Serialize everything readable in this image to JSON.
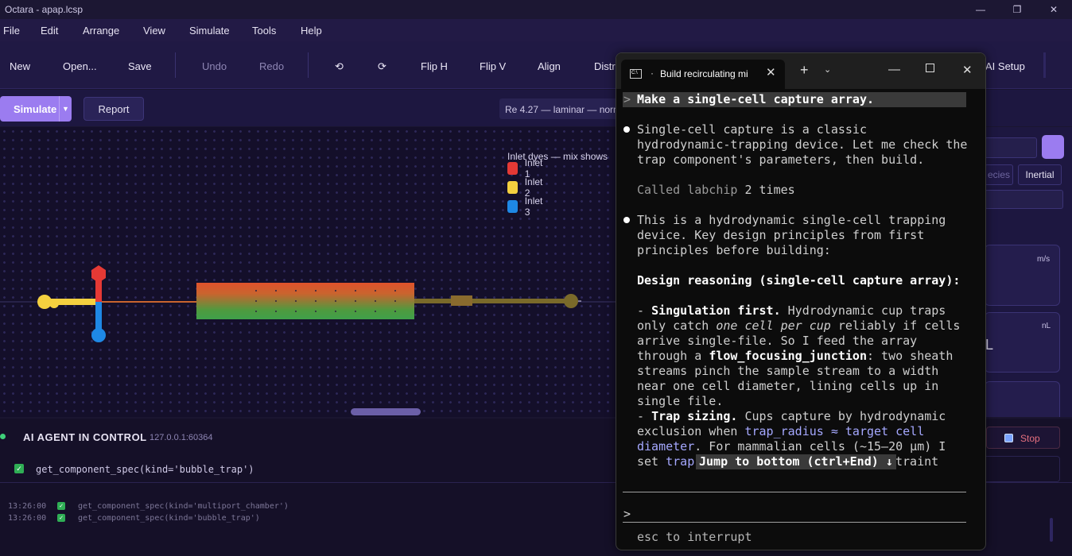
{
  "window": {
    "title": "Octara - apap.lcsp"
  },
  "menu": [
    "File",
    "Edit",
    "Arrange",
    "View",
    "Simulate",
    "Tools",
    "Help"
  ],
  "toolbar": {
    "new": "New",
    "open": "Open...",
    "save": "Save",
    "undo": "Undo",
    "redo": "Redo",
    "rotate_ccw": "⟲",
    "rotate_cw": "⟳",
    "flip_h": "Flip H",
    "flip_v": "Flip V",
    "align": "Align",
    "distribute": "Distri",
    "ai_setup": "AI Setup"
  },
  "runbar": {
    "simulate": "Simulate",
    "report": "Report",
    "status": "Re 4.27 — laminar — norm"
  },
  "legend": {
    "title": "Inlet dyes — mix shows",
    "items": [
      {
        "label": "Inlet 1",
        "color": "#e53935"
      },
      {
        "label": "Inlet 2",
        "color": "#f4d03f"
      },
      {
        "label": "Inlet 3",
        "color": "#1e88e5"
      }
    ]
  },
  "right_panel": {
    "tag1": "ecies",
    "tag2": "Inertial",
    "unit1": "m/s",
    "unit2": "nL",
    "card2_value": "L"
  },
  "agent": {
    "label": "AI AGENT IN CONTROL",
    "address": "127.0.0.1:60364",
    "stop": "Stop",
    "current_call": "get_component_spec(kind='bubble_trap')",
    "log": [
      {
        "time": "13:26:00",
        "text": "get_component_spec(kind='multiport_chamber')"
      },
      {
        "time": "13:26:00",
        "text": "get_component_spec(kind='bubble_trap')"
      }
    ]
  },
  "terminal": {
    "tab_title": "Build recirculating mi",
    "prompt_marker": ">",
    "user_prompt": "Make a single-cell capture array.",
    "msg1": [
      "Single-cell capture is a classic",
      "hydrodynamic-trapping device. Let me check the",
      "trap component's parameters, then build."
    ],
    "called_prefix": "Called ",
    "called_tool": "labchip",
    "called_count": "2 times",
    "msg2": [
      "This is a hydrodynamic single-cell trapping",
      "device. Key design principles from first",
      "principles before building:"
    ],
    "heading": "Design reasoning (single-cell capture array):",
    "p1_dash": "- ",
    "p1_bold": "Singulation first.",
    "p1_rest": " Hydrodynamic cup traps",
    "p1_l2a": "only catch ",
    "p1_l2i": "one cell per cup",
    "p1_l2b": " reliably if cells",
    "p1_l3": "arrive single-file. So I feed the array",
    "p1_l4a": "through a ",
    "p1_l4b": "flow_focusing_junction",
    "p1_l4c": ": two sheath",
    "p1_l5": "streams pinch the sample stream to a width",
    "p1_l6": "near one cell diameter, lining cells up in",
    "p1_l7": "single file.",
    "p2_bold": "Trap sizing.",
    "p2_rest": " Cups capture by hydrodynamic",
    "p2_l2a": "exclusion when ",
    "p2_l2b": "trap_radius ≈ target cell",
    "p2_l3a": "diameter",
    "p2_l3b": ". For mammalian cells (~15–20 μm) I",
    "p2_l4a": "set ",
    "p2_l4b": "trap",
    "p2_l4c": "traint",
    "jump": "Jump to bottom (ctrl+End) ↓",
    "input_prompt": ">",
    "footer": "esc to interrupt"
  }
}
